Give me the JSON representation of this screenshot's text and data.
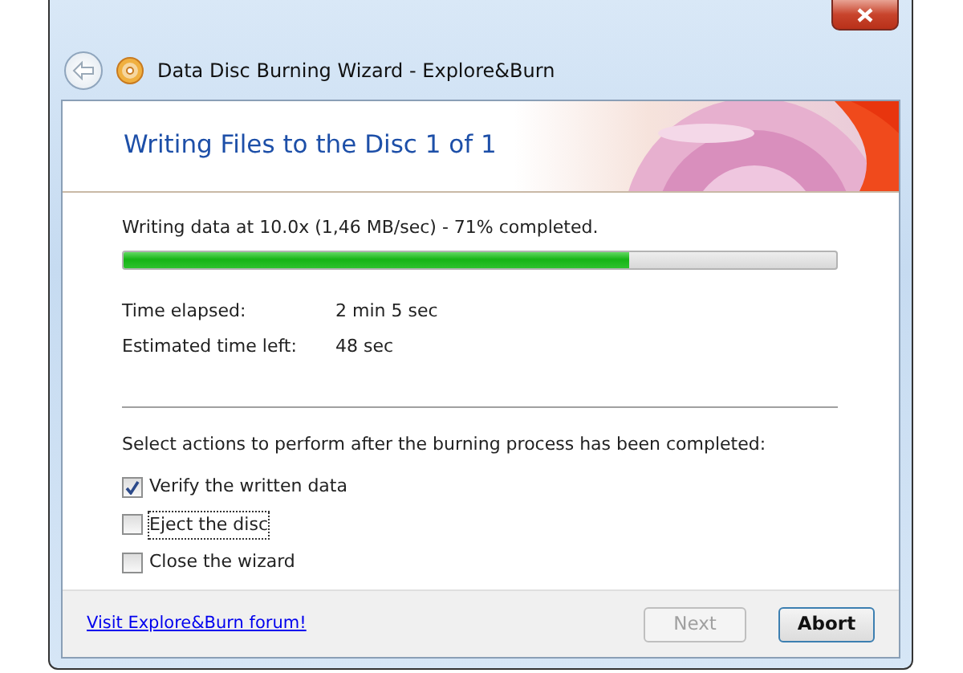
{
  "window": {
    "title": "Data Disc Burning Wizard - Explore&Burn"
  },
  "header": {
    "title": "Writing Files to the Disc 1 of 1"
  },
  "progress": {
    "status": "Writing data at 10.0x (1,46 MB/sec) - 71% completed.",
    "level": 0.71
  },
  "times": [
    {
      "label": "Time elapsed:",
      "value": "2 min 5 sec"
    },
    {
      "label": "Estimated time left:",
      "value": "48 sec"
    }
  ],
  "actions": {
    "prompt": "Select actions to perform after the burning process has been completed:",
    "options": [
      {
        "label": "Verify the written data",
        "checked": true,
        "focused": false
      },
      {
        "label": "Eject the disc",
        "checked": false,
        "focused": true
      },
      {
        "label": "Close the wizard",
        "checked": false,
        "focused": false
      }
    ]
  },
  "footer": {
    "link": "Visit Explore&Burn forum!",
    "buttons": [
      {
        "label": "Next",
        "disabled": true
      },
      {
        "label": "Abort",
        "disabled": false
      }
    ]
  }
}
